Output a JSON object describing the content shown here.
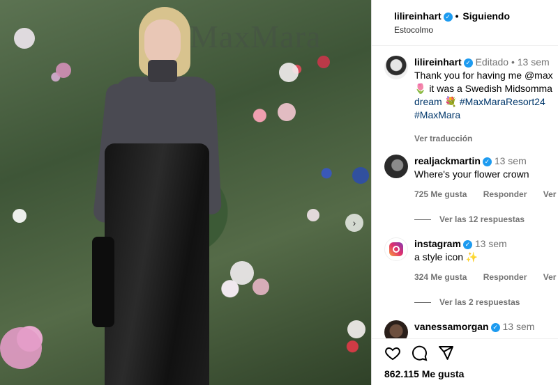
{
  "photo": {
    "brand_text": "MaxMara",
    "next_icon": "chevron-right-icon"
  },
  "header": {
    "username": "lilireinhart",
    "separator": "•",
    "follow_label": "Siguiendo",
    "location": "Estocolmo"
  },
  "caption": {
    "username": "lilireinhart",
    "edited": "Editado",
    "time": "13 sem",
    "lines": [
      "Thank you for having me @max",
      "🌷 it was a Swedish Midsomma",
      "dream 💐 #MaxMaraResort24",
      "#MaxMara"
    ],
    "translate": "Ver traducción"
  },
  "comments": [
    {
      "username": "realjackmartin",
      "time": "13 sem",
      "text": "Where's your flower crown",
      "likes": "725 Me gusta",
      "reply": "Responder",
      "translate": "Ver tra",
      "view_replies": "Ver las 12 respuestas"
    },
    {
      "username": "instagram",
      "time": "13 sem",
      "text": "a style icon ✨",
      "likes": "324 Me gusta",
      "reply": "Responder",
      "translate": "Ver tra",
      "view_replies": "Ver las 2 respuestas"
    },
    {
      "username": "vanessamorgan",
      "time": "13 sem"
    }
  ],
  "footer": {
    "like_count": "862.115 Me gusta",
    "icons": [
      "heart-icon",
      "comment-icon",
      "share-icon"
    ]
  },
  "colors": {
    "verified": "#1d9bf0",
    "link": "#00376b",
    "muted": "#737373"
  }
}
